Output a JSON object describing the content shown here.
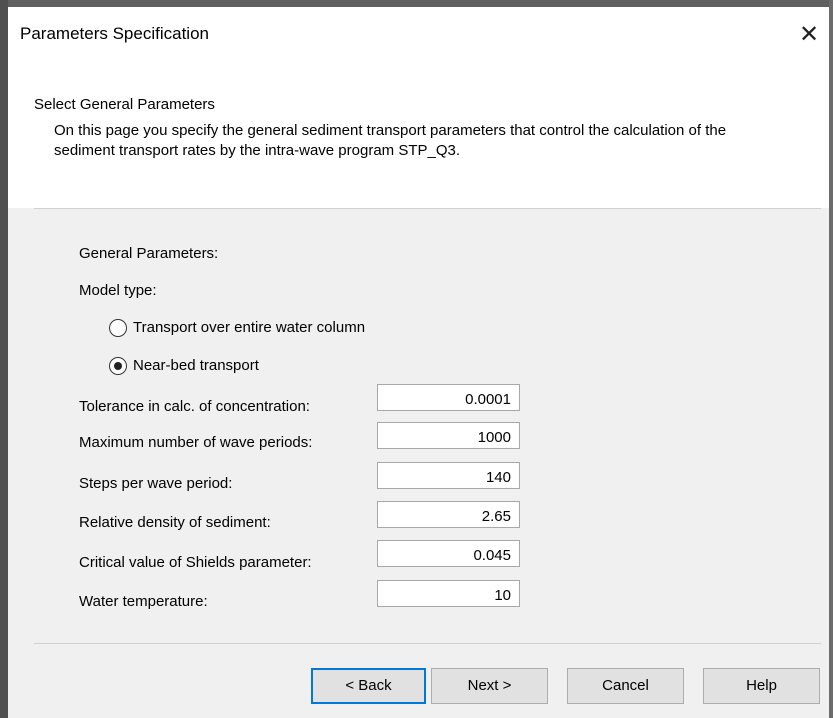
{
  "window": {
    "title": "Parameters Specification",
    "close_glyph": "✕"
  },
  "header": {
    "heading": "Select General Parameters",
    "description": "On this page you specify the general sediment transport parameters that control the calculation of the sediment transport rates by the intra-wave program STP_Q3."
  },
  "general": {
    "title": "General Parameters:",
    "model_type_label": "Model type:",
    "radio_entire": "Transport over entire water column",
    "radio_nearbed": "Near-bed transport",
    "selected": "Near-bed transport"
  },
  "params": {
    "tolerance": {
      "label": "Tolerance in calc. of concentration:",
      "value": "0.0001"
    },
    "max_periods": {
      "label": "Maximum number of wave periods:",
      "value": "1000"
    },
    "steps": {
      "label": "Steps per wave period:",
      "value": "140"
    },
    "density": {
      "label": "Relative density of sediment:",
      "value": "2.65"
    },
    "shields": {
      "label": "Critical value of Shields parameter:",
      "value": "0.045"
    },
    "temperature": {
      "label": "Water temperature:",
      "value": "10"
    }
  },
  "buttons": {
    "back": "< Back",
    "next": "Next >",
    "cancel": "Cancel",
    "help": "Help"
  }
}
